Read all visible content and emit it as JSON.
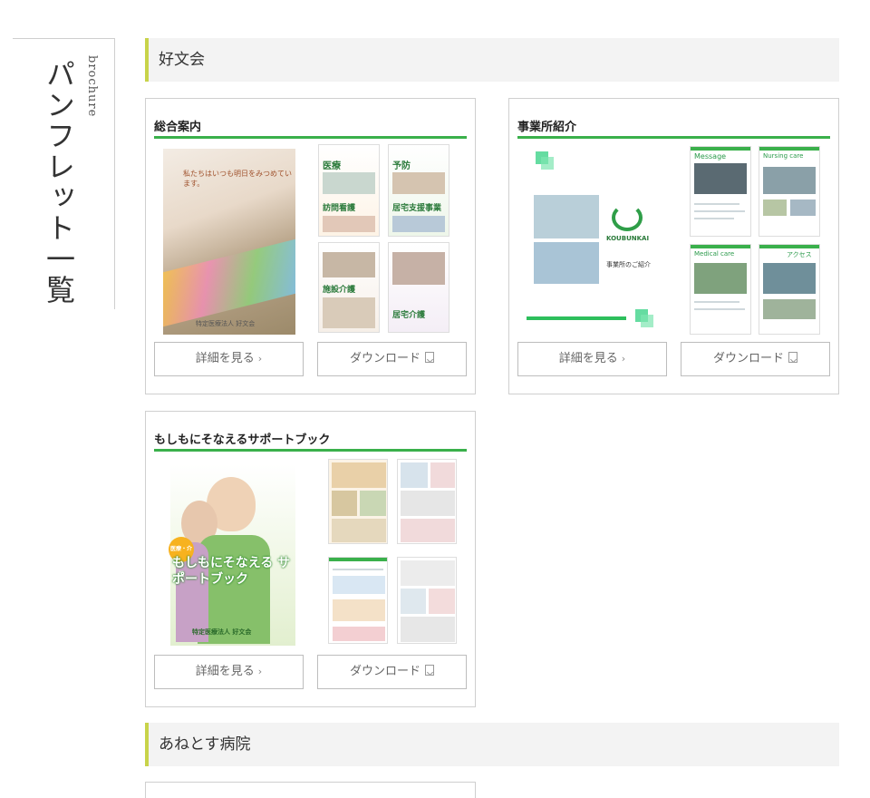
{
  "side": {
    "title_jp": "パンフレット一覧",
    "title_en": "brochure"
  },
  "sections": [
    {
      "label": "好文会"
    },
    {
      "label": "あねとす病院"
    }
  ],
  "cards": [
    {
      "title": "総合案内",
      "detail_label": "詳細を見る",
      "download_label": "ダウンロード",
      "cover_caption": "私たちはいつも明日をみつめています。",
      "cover_org": "特定医療法人 好文会",
      "page_titles": [
        "医療",
        "予防",
        "訪問看護",
        "居宅支援事業",
        "施設介護",
        "居宅介護"
      ]
    },
    {
      "title": "事業所紹介",
      "detail_label": "詳細を見る",
      "download_label": "ダウンロード",
      "logo_text": "KOUBUNKAI",
      "logo_sub": "事業所のご紹介",
      "page_titles": [
        "Message",
        "Nursing care",
        "Medical care",
        "アクセス"
      ]
    },
    {
      "title": "もしもにそなえるサポートブック",
      "detail_label": "詳細を見る",
      "download_label": "ダウンロード",
      "cover_badge": "医療・介護",
      "cover_title": "もしもにそなえる サポートブック",
      "cover_org": "特定医療法人 好文会"
    }
  ],
  "colors": {
    "accent_green": "#3ab04b",
    "section_bar": "#c8d34a"
  }
}
